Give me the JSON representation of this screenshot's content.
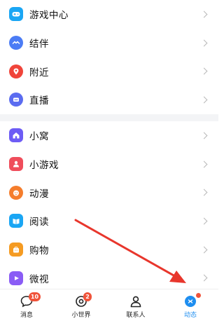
{
  "menu": {
    "group1": [
      {
        "label": "游戏中心",
        "icon": "gamepad-icon",
        "color": "#1aa6f4"
      },
      {
        "label": "结伴",
        "icon": "companion-icon",
        "color": "#4b7cf5"
      },
      {
        "label": "附近",
        "icon": "location-pin-icon",
        "color": "#f0443a"
      },
      {
        "label": "直播",
        "icon": "live-broadcast-icon",
        "color": "#5b6cf0"
      }
    ],
    "group2": [
      {
        "label": "小窝",
        "icon": "home-icon",
        "color": "#6d5cf5"
      },
      {
        "label": "小游戏",
        "icon": "mini-game-icon",
        "color": "#ef4d5b"
      },
      {
        "label": "动漫",
        "icon": "anime-icon",
        "color": "#f57d2c"
      },
      {
        "label": "阅读",
        "icon": "reading-icon",
        "color": "#1aa6f4"
      },
      {
        "label": "购物",
        "icon": "shopping-icon",
        "color": "#f59b22"
      },
      {
        "label": "微视",
        "icon": "weishi-icon",
        "color": "#8a5cf5"
      }
    ]
  },
  "tabbar": {
    "messages": {
      "label": "消息",
      "badge": "10"
    },
    "mini_world": {
      "label": "小世界",
      "badge": "2"
    },
    "contacts": {
      "label": "联系人"
    },
    "dynamics": {
      "label": "动态"
    }
  },
  "colors": {
    "active_tab": "#1e8ef0",
    "badge": "#f0533a",
    "annotation_arrow": "#e8362c"
  }
}
